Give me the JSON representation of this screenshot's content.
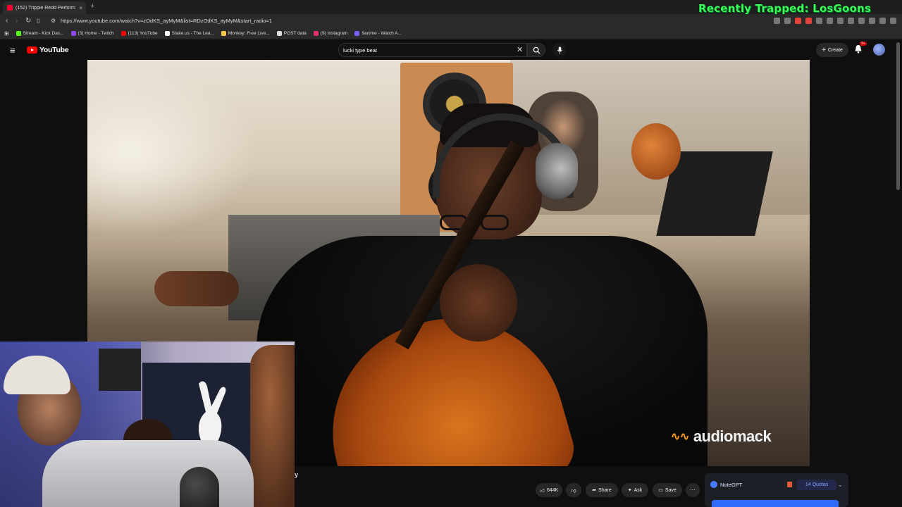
{
  "browser": {
    "tab": {
      "title": "(152) Trippie Redd Perform",
      "close": "×"
    },
    "new_tab": "+",
    "url": "https://www.youtube.com/watch?v=zOdKS_ayMyM&list=RDzOdKS_ayMyM&start_radio=1",
    "bookmarks": [
      {
        "label": "Stream - Kick Das...",
        "color": "#53fc18"
      },
      {
        "label": "(3) Home - Twitch",
        "color": "#9146ff"
      },
      {
        "label": "(113) YouTube",
        "color": "#ff0000"
      },
      {
        "label": "Stake.us - The Lea...",
        "color": "#ffffff"
      },
      {
        "label": "Monkey: Free Live...",
        "color": "#f5c542"
      },
      {
        "label": "POST data",
        "color": "#dddddd"
      },
      {
        "label": "(9) Instagram",
        "color": "#e1306c"
      },
      {
        "label": "9anime - Watch A...",
        "color": "#7b5cff"
      }
    ]
  },
  "stream_overlay": {
    "text": "Recently Trapped: LosGoons"
  },
  "youtube": {
    "logo_text": "YouTube",
    "search": {
      "value": "lucki type beat"
    },
    "create_label": "Create",
    "notifications_badge": "9+"
  },
  "video": {
    "watermark": "audiomack",
    "title_fragment": "y"
  },
  "actions": {
    "likes": "644K",
    "share": "Share",
    "ask": "Ask",
    "save": "Save"
  },
  "notegpt": {
    "brand": "NoteGPT",
    "quotas": "14 Quotas"
  }
}
